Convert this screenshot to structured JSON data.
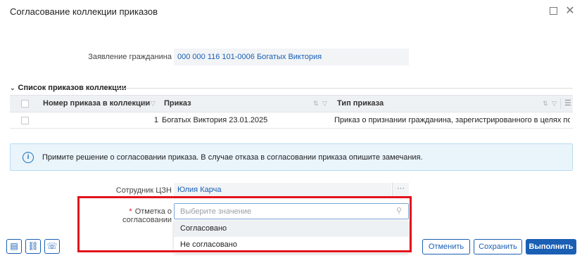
{
  "window": {
    "title": "Согласование коллекции приказов",
    "maximize_icon": "maximize-icon",
    "close_icon": "close-icon",
    "close_glyph": "✕"
  },
  "application": {
    "label": "Заявление гражданина",
    "value": "000 000 116 101-0006 Богатых Виктория"
  },
  "orders_section": {
    "title": "Список приказов коллекции",
    "columns": [
      "Номер приказа в коллекции",
      "Приказ",
      "Тип приказа"
    ],
    "rows": [
      {
        "number": "1",
        "order": "Богатых Виктория 23.01.2025",
        "type": "Приказ о признании гражданина, зарегистрированного в целях поиск..."
      }
    ]
  },
  "info": {
    "icon": "info-icon",
    "text": "Примите решение о согласовании приказа. В случае отказа в согласовании приказа опишите замечания."
  },
  "employee": {
    "label": "Сотрудник ЦЗН",
    "value": "Юлия Карча",
    "button": "···"
  },
  "approval": {
    "required_mark": "*",
    "label": "Отметка о согласовании",
    "placeholder": "Выберите значение",
    "options": [
      "Согласовано",
      "Не согласовано"
    ],
    "highlighted_option": "Согласовано"
  },
  "footer": {
    "icons": [
      "document-icon",
      "link-icon",
      "comment-icon"
    ],
    "cancel": "Отменить",
    "save": "Сохранить",
    "execute": "Выполнить"
  },
  "colors": {
    "accent": "#1a5fb4",
    "highlight_frame": "#e3131b",
    "info_background": "#e9f4fb"
  }
}
